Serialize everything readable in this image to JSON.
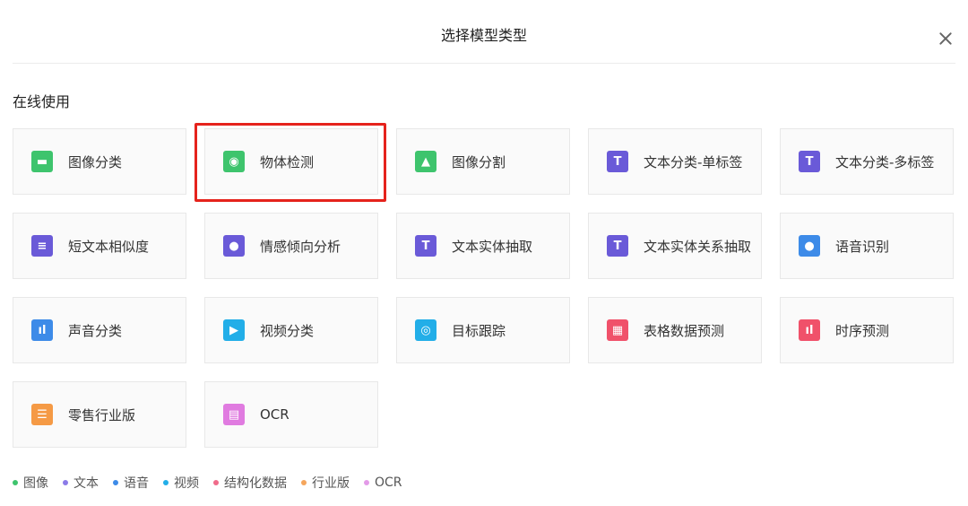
{
  "dialog": {
    "title": "选择模型类型"
  },
  "section": {
    "title": "在线使用"
  },
  "cards": [
    {
      "label": "图像分类",
      "icon": "image-classify-icon",
      "color": "#3ec46d",
      "glyph": "▬",
      "selected": false
    },
    {
      "label": "物体检测",
      "icon": "object-detect-icon",
      "color": "#3ec46d",
      "glyph": "◉",
      "selected": true
    },
    {
      "label": "图像分割",
      "icon": "image-segment-icon",
      "color": "#3ec46d",
      "glyph": "▲",
      "selected": false
    },
    {
      "label": "文本分类-单标签",
      "icon": "text-classify-single-icon",
      "color": "#6a5ad8",
      "glyph": "T",
      "selected": false
    },
    {
      "label": "文本分类-多标签",
      "icon": "text-classify-multi-icon",
      "color": "#6a5ad8",
      "glyph": "T",
      "selected": false
    },
    {
      "label": "短文本相似度",
      "icon": "short-text-similarity-icon",
      "color": "#6a5ad8",
      "glyph": "≡",
      "selected": false
    },
    {
      "label": "情感倾向分析",
      "icon": "sentiment-analysis-icon",
      "color": "#6a5ad8",
      "glyph": "●",
      "selected": false
    },
    {
      "label": "文本实体抽取",
      "icon": "text-entity-extract-icon",
      "color": "#6a5ad8",
      "glyph": "T",
      "selected": false
    },
    {
      "label": "文本实体关系抽取",
      "icon": "text-relation-extract-icon",
      "color": "#6a5ad8",
      "glyph": "T",
      "selected": false
    },
    {
      "label": "语音识别",
      "icon": "microphone-icon",
      "color": "#3d8be8",
      "glyph": "●",
      "selected": false
    },
    {
      "label": "声音分类",
      "icon": "sound-classify-icon",
      "color": "#3d8be8",
      "glyph": "ıl",
      "selected": false
    },
    {
      "label": "视频分类",
      "icon": "video-classify-icon",
      "color": "#22aee8",
      "glyph": "▶",
      "selected": false
    },
    {
      "label": "目标跟踪",
      "icon": "target-tracking-icon",
      "color": "#22aee8",
      "glyph": "◎",
      "selected": false
    },
    {
      "label": "表格数据预测",
      "icon": "table-data-predict-icon",
      "color": "#f0516a",
      "glyph": "▦",
      "selected": false
    },
    {
      "label": "时序预测",
      "icon": "timeseries-predict-icon",
      "color": "#f0516a",
      "glyph": "ıl",
      "selected": false
    },
    {
      "label": "零售行业版",
      "icon": "retail-industry-icon",
      "color": "#f59a45",
      "glyph": "☰",
      "selected": false
    },
    {
      "label": "OCR",
      "icon": "ocr-icon",
      "color": "#e07be0",
      "glyph": "▤",
      "selected": false
    }
  ],
  "legend": [
    {
      "label": "图像",
      "color": "#3ec46d"
    },
    {
      "label": "文本",
      "color": "#8b7be8"
    },
    {
      "label": "语音",
      "color": "#3d8be8"
    },
    {
      "label": "视频",
      "color": "#22aee8"
    },
    {
      "label": "结构化数据",
      "color": "#f06b8a"
    },
    {
      "label": "行业版",
      "color": "#f5a65c"
    },
    {
      "label": "OCR",
      "color": "#e39be8"
    }
  ]
}
